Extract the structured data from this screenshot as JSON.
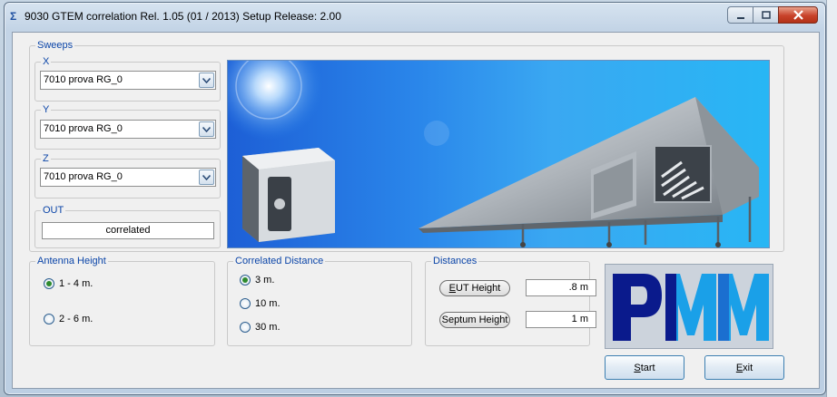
{
  "window": {
    "title": "9030 GTEM correlation Rel. 1.05 (01 / 2013)   Setup Release: 2.00",
    "icon": "sigma-icon",
    "controls": [
      "minimize-icon",
      "maximize-icon",
      "close-icon"
    ]
  },
  "sweeps": {
    "label": "Sweeps",
    "x": {
      "label": "X",
      "value": "7010 prova RG_0"
    },
    "y": {
      "label": "Y",
      "value": "7010 prova RG_0"
    },
    "z": {
      "label": "Z",
      "value": "7010 prova RG_0"
    }
  },
  "out": {
    "label": "OUT",
    "value": "correlated"
  },
  "antenna_height": {
    "label": "Antenna Height",
    "options": [
      {
        "label": "1 - 4 m.",
        "selected": true
      },
      {
        "label": "2 - 6 m.",
        "selected": false
      }
    ]
  },
  "correlated_distance": {
    "label": "Correlated Distance",
    "options": [
      {
        "label": "3 m.",
        "selected": true
      },
      {
        "label": "10 m.",
        "selected": false
      },
      {
        "label": "30 m.",
        "selected": false
      }
    ]
  },
  "distances": {
    "label": "Distances",
    "eut_height": {
      "label_prefix": "",
      "label_underlined": "E",
      "label_rest": "UT Height",
      "value": ".8 m"
    },
    "septum_height": {
      "label": "Septum Height",
      "value": "1 m"
    }
  },
  "logo": {
    "text": "PMM",
    "colors": {
      "dark": "#0a1a8c",
      "light": "#1aa0e8"
    }
  },
  "buttons": {
    "start": {
      "underlined": "S",
      "rest": "tart"
    },
    "exit": {
      "underlined": "E",
      "rest": "xit"
    }
  },
  "colors": {
    "legend": "#0b45a8",
    "accent": "#2a86ea"
  }
}
